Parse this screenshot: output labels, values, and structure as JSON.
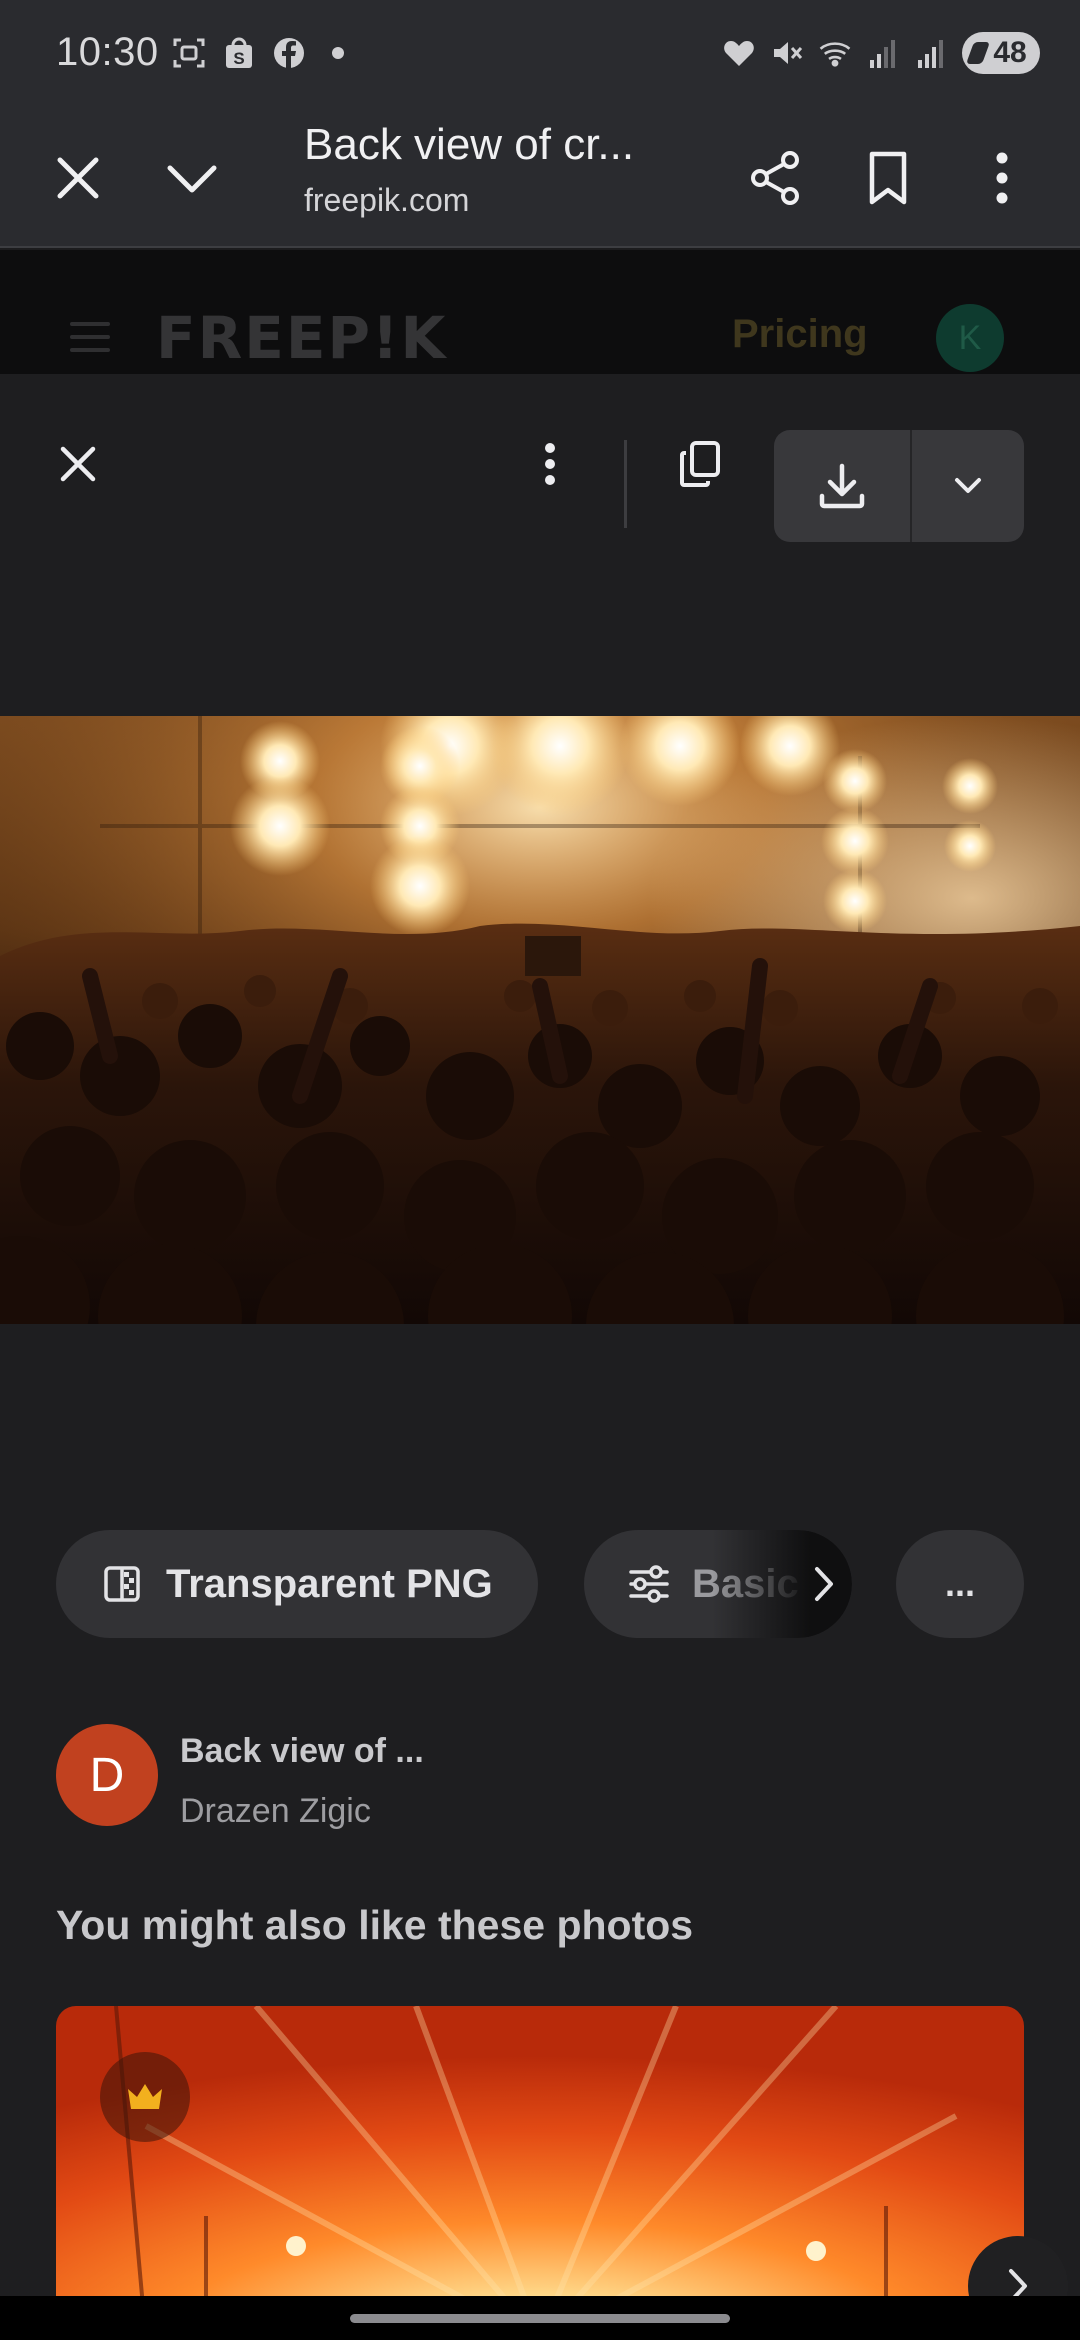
{
  "status_bar": {
    "time": "10:30",
    "battery": "48",
    "left_icons": [
      "screenshot-icon",
      "shop-icon",
      "facebook-icon"
    ],
    "right_icons": [
      "heart-icon",
      "mute-icon",
      "wifi-icon",
      "signal-icon",
      "signal-icon"
    ]
  },
  "custom_tab": {
    "title": "Back view of cr...",
    "url": "freepik.com"
  },
  "site_header": {
    "logo": "FREEP!K",
    "pricing": "Pricing",
    "avatar_letter": "K"
  },
  "chips": {
    "transparent_png": "Transparent PNG",
    "basic": "Basic",
    "more": "..."
  },
  "author": {
    "avatar_letter": "D",
    "title": "Back view of ...",
    "name": "Drazen Zigic"
  },
  "section_title": "You might also like these photos",
  "colors": {
    "background": "#1e1e20",
    "chip": "#323235",
    "avatar": "#c1411f",
    "premium_crown": "#f2b01e"
  }
}
